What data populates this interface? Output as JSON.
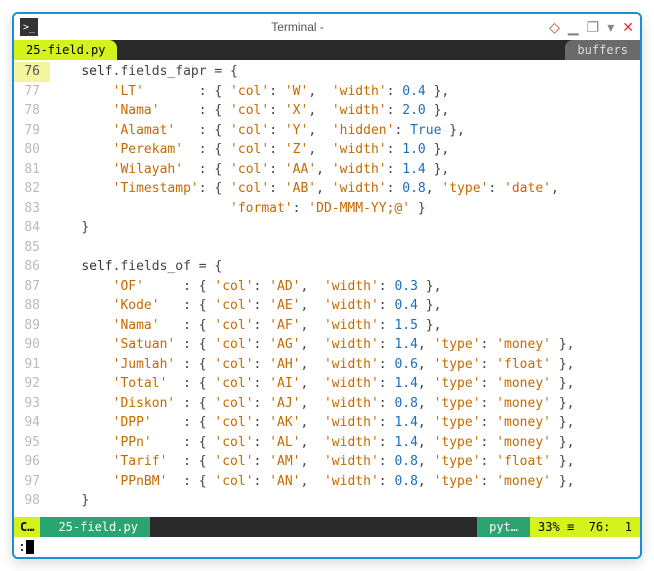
{
  "titlebar": {
    "text": "Terminal -"
  },
  "buffer": {
    "tab": "25-field.py",
    "label": "buffers"
  },
  "lines": [
    {
      "n": 76,
      "html": "    <span class='self'>self</span><span class='p'>.fields_fapr = {</span>"
    },
    {
      "n": 77,
      "html": "        <span class='s'>'LT'</span>       <span class='p'>: {</span> <span class='s'>'col'</span><span class='p'>:</span> <span class='s'>'W'</span><span class='p'>,</span>  <span class='s'>'width'</span><span class='p'>:</span> <span class='n'>0.4</span> <span class='p'>},</span>"
    },
    {
      "n": 78,
      "html": "        <span class='s'>'Nama'</span>     <span class='p'>: {</span> <span class='s'>'col'</span><span class='p'>:</span> <span class='s'>'X'</span><span class='p'>,</span>  <span class='s'>'width'</span><span class='p'>:</span> <span class='n'>2.0</span> <span class='p'>},</span>"
    },
    {
      "n": 79,
      "html": "        <span class='s'>'Alamat'</span>   <span class='p'>: {</span> <span class='s'>'col'</span><span class='p'>:</span> <span class='s'>'Y'</span><span class='p'>,</span>  <span class='s'>'hidden'</span><span class='p'>:</span> <span class='b'>True</span> <span class='p'>},</span>"
    },
    {
      "n": 80,
      "html": "        <span class='s'>'Perekam'</span>  <span class='p'>: {</span> <span class='s'>'col'</span><span class='p'>:</span> <span class='s'>'Z'</span><span class='p'>,</span>  <span class='s'>'width'</span><span class='p'>:</span> <span class='n'>1.0</span> <span class='p'>},</span>"
    },
    {
      "n": 81,
      "html": "        <span class='s'>'Wilayah'</span>  <span class='p'>: {</span> <span class='s'>'col'</span><span class='p'>:</span> <span class='s'>'AA'</span><span class='p'>,</span> <span class='s'>'width'</span><span class='p'>:</span> <span class='n'>1.4</span> <span class='p'>},</span>"
    },
    {
      "n": 82,
      "html": "        <span class='s'>'Timestamp'</span><span class='p'>: {</span> <span class='s'>'col'</span><span class='p'>:</span> <span class='s'>'AB'</span><span class='p'>,</span> <span class='s'>'width'</span><span class='p'>:</span> <span class='n'>0.8</span><span class='p'>,</span> <span class='s'>'type'</span><span class='p'>:</span> <span class='s'>'date'</span><span class='p'>,</span>"
    },
    {
      "n": 83,
      "html": "                       <span class='s'>'format'</span><span class='p'>:</span> <span class='s'>'DD-MMM-YY;@'</span> <span class='p'>}</span>"
    },
    {
      "n": 84,
      "html": "    <span class='p'>}</span>"
    },
    {
      "n": 85,
      "html": ""
    },
    {
      "n": 86,
      "html": "    <span class='self'>self</span><span class='p'>.fields_of = {</span>"
    },
    {
      "n": 87,
      "html": "        <span class='s'>'OF'</span>     <span class='p'>: {</span> <span class='s'>'col'</span><span class='p'>:</span> <span class='s'>'AD'</span><span class='p'>,</span>  <span class='s'>'width'</span><span class='p'>:</span> <span class='n'>0.3</span> <span class='p'>},</span>"
    },
    {
      "n": 88,
      "html": "        <span class='s'>'Kode'</span>   <span class='p'>: {</span> <span class='s'>'col'</span><span class='p'>:</span> <span class='s'>'AE'</span><span class='p'>,</span>  <span class='s'>'width'</span><span class='p'>:</span> <span class='n'>0.4</span> <span class='p'>},</span>"
    },
    {
      "n": 89,
      "html": "        <span class='s'>'Nama'</span>   <span class='p'>: {</span> <span class='s'>'col'</span><span class='p'>:</span> <span class='s'>'AF'</span><span class='p'>,</span>  <span class='s'>'width'</span><span class='p'>:</span> <span class='n'>1.5</span> <span class='p'>},</span>"
    },
    {
      "n": 90,
      "html": "        <span class='s'>'Satuan'</span> <span class='p'>: {</span> <span class='s'>'col'</span><span class='p'>:</span> <span class='s'>'AG'</span><span class='p'>,</span>  <span class='s'>'width'</span><span class='p'>:</span> <span class='n'>1.4</span><span class='p'>,</span> <span class='s'>'type'</span><span class='p'>:</span> <span class='s'>'money'</span> <span class='p'>},</span>"
    },
    {
      "n": 91,
      "html": "        <span class='s'>'Jumlah'</span> <span class='p'>: {</span> <span class='s'>'col'</span><span class='p'>:</span> <span class='s'>'AH'</span><span class='p'>,</span>  <span class='s'>'width'</span><span class='p'>:</span> <span class='n'>0.6</span><span class='p'>,</span> <span class='s'>'type'</span><span class='p'>:</span> <span class='s'>'float'</span> <span class='p'>},</span>"
    },
    {
      "n": 92,
      "html": "        <span class='s'>'Total'</span>  <span class='p'>: {</span> <span class='s'>'col'</span><span class='p'>:</span> <span class='s'>'AI'</span><span class='p'>,</span>  <span class='s'>'width'</span><span class='p'>:</span> <span class='n'>1.4</span><span class='p'>,</span> <span class='s'>'type'</span><span class='p'>:</span> <span class='s'>'money'</span> <span class='p'>},</span>"
    },
    {
      "n": 93,
      "html": "        <span class='s'>'Diskon'</span> <span class='p'>: {</span> <span class='s'>'col'</span><span class='p'>:</span> <span class='s'>'AJ'</span><span class='p'>,</span>  <span class='s'>'width'</span><span class='p'>:</span> <span class='n'>0.8</span><span class='p'>,</span> <span class='s'>'type'</span><span class='p'>:</span> <span class='s'>'money'</span> <span class='p'>},</span>"
    },
    {
      "n": 94,
      "html": "        <span class='s'>'DPP'</span>    <span class='p'>: {</span> <span class='s'>'col'</span><span class='p'>:</span> <span class='s'>'AK'</span><span class='p'>,</span>  <span class='s'>'width'</span><span class='p'>:</span> <span class='n'>1.4</span><span class='p'>,</span> <span class='s'>'type'</span><span class='p'>:</span> <span class='s'>'money'</span> <span class='p'>},</span>"
    },
    {
      "n": 95,
      "html": "        <span class='s'>'PPn'</span>    <span class='p'>: {</span> <span class='s'>'col'</span><span class='p'>:</span> <span class='s'>'AL'</span><span class='p'>,</span>  <span class='s'>'width'</span><span class='p'>:</span> <span class='n'>1.4</span><span class='p'>,</span> <span class='s'>'type'</span><span class='p'>:</span> <span class='s'>'money'</span> <span class='p'>},</span>"
    },
    {
      "n": 96,
      "html": "        <span class='s'>'Tarif'</span>  <span class='p'>: {</span> <span class='s'>'col'</span><span class='p'>:</span> <span class='s'>'AM'</span><span class='p'>,</span>  <span class='s'>'width'</span><span class='p'>:</span> <span class='n'>0.8</span><span class='p'>,</span> <span class='s'>'type'</span><span class='p'>:</span> <span class='s'>'float'</span> <span class='p'>},</span>"
    },
    {
      "n": 97,
      "html": "        <span class='s'>'PPnBM'</span>  <span class='p'>: {</span> <span class='s'>'col'</span><span class='p'>:</span> <span class='s'>'AN'</span><span class='p'>,</span>  <span class='s'>'width'</span><span class='p'>:</span> <span class='n'>0.8</span><span class='p'>,</span> <span class='s'>'type'</span><span class='p'>:</span> <span class='s'>'money'</span> <span class='p'>},</span>"
    },
    {
      "n": 98,
      "html": "    <span class='p'>}</span>"
    }
  ],
  "status": {
    "mode": "C…",
    "file": "25-field.py",
    "filetype": "pyt…",
    "percent": "33%",
    "sep": "≡",
    "line": "76",
    "col": "1"
  },
  "cmd": {
    "prefix": ":"
  }
}
